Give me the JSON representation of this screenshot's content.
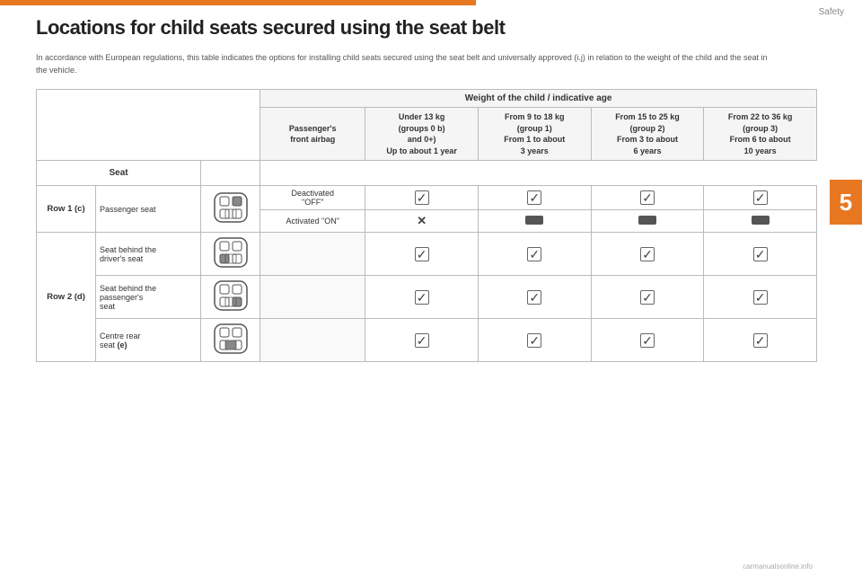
{
  "topBar": {},
  "sectionLabel": "Safety",
  "chapterNumber": "5",
  "title": "Locations for child seats secured using the seat belt",
  "intro": "In accordance with European regulations, this table indicates the options for installing child seats secured using the seat belt and universally approved (i.j) in relation to the weight of the child and the seat in the vehicle.",
  "table": {
    "weightHeader": "Weight of the child / indicative age",
    "columns": [
      {
        "header": "Passenger's\nfront airbag"
      },
      {
        "header": "Under 13 kg\n(groups 0 (b)\nand 0+)\nUp to about 1 year"
      },
      {
        "header": "From 9 to 18 kg\n(group 1)\nFrom 1 to about\n3 years"
      },
      {
        "header": "From 15 to 25 kg\n(group 2)\nFrom 3 to about\n6 years"
      },
      {
        "header": "From 22 to 36 kg\n(group 3)\nFrom 6 to about\n10 years"
      }
    ],
    "rows": [
      {
        "rowLabel": "Row 1 (c)",
        "seatName": "Passenger seat",
        "subRows": [
          {
            "airbag": "Deactivated\n\"OFF\"",
            "col1": "check",
            "col2": "check",
            "col3": "check",
            "col4": "check"
          },
          {
            "airbag": "Activated \"ON\"",
            "col1": "cross",
            "col2": "isofix",
            "col3": "isofix",
            "col4": "isofix"
          }
        ]
      },
      {
        "rowLabel": "Row 2 (d)",
        "subRows": [
          {
            "seatName": "Seat behind the driver's seat",
            "airbag": "",
            "col1": "check",
            "col2": "check",
            "col3": "check",
            "col4": "check"
          },
          {
            "seatName": "Seat behind the passenger's seat",
            "airbag": "",
            "col1": "check",
            "col2": "check",
            "col3": "check",
            "col4": "check"
          },
          {
            "seatName": "Centre rear seat (e)",
            "airbag": "",
            "col1": "check",
            "col2": "check",
            "col3": "check",
            "col4": "check"
          }
        ]
      }
    ]
  },
  "watermark": "carmanualsonline.info"
}
